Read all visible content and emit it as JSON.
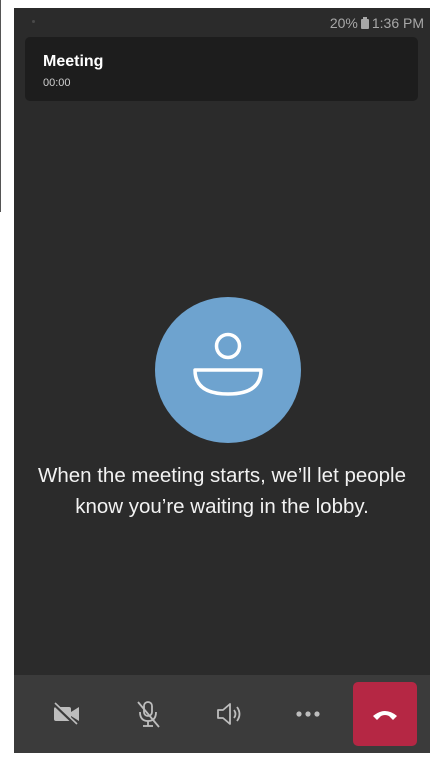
{
  "status_bar": {
    "battery": "20%",
    "time": "1:36 PM"
  },
  "meeting": {
    "title": "Meeting",
    "timer": "00:00"
  },
  "lobby": {
    "message": "When the meeting starts, we’ll let people know you’re waiting in the lobby."
  },
  "call_controls": {
    "buttons": [
      "camera-off",
      "mic-off",
      "speaker",
      "more-options",
      "hang-up"
    ]
  },
  "colors": {
    "background": "#2b2b2b",
    "header_card": "#1d1d1d",
    "avatar": "#6ea3cf",
    "control_bar": "#3b3b3b",
    "hang_up": "#b52744"
  }
}
